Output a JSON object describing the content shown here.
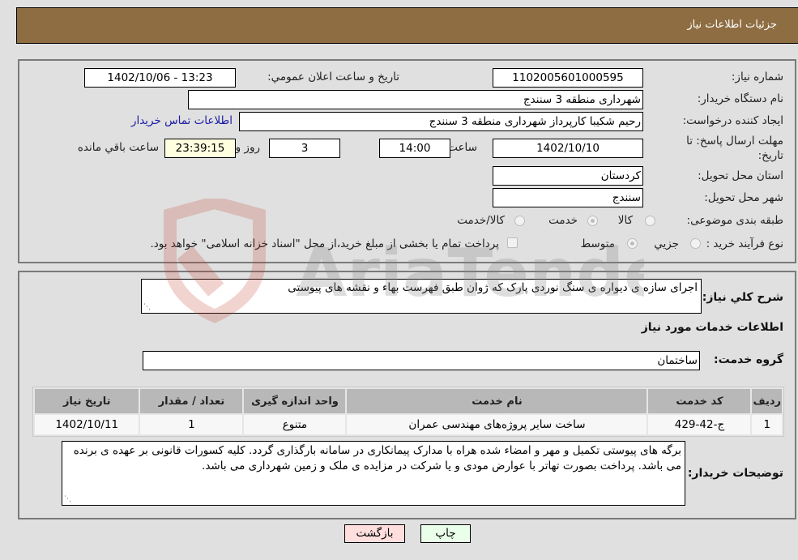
{
  "header": {
    "title": "جزئیات اطلاعات نیاز"
  },
  "form": {
    "need_number": {
      "label": "شماره نیاز:",
      "value": "1102005601000595"
    },
    "announce": {
      "label": "تاریخ و ساعت اعلان عمومي:",
      "value": "1402/10/06 - 13:23"
    },
    "buyer_org": {
      "label": "نام دستگاه خریدار:",
      "value": "شهرداری منطقه 3 سنندج"
    },
    "requester": {
      "label": "ایجاد کننده درخواست:",
      "value": "رحیم شکیبا کارپرداز شهرداری منطقه 3 سنندج",
      "contact_link": "اطلاعات تماس خریدار"
    },
    "deadline": {
      "label": "مهلت ارسال پاسخ: تا تاریخ:",
      "date": "1402/10/10",
      "time_label": "ساعت",
      "time": "14:00",
      "days": "3",
      "days_label": "روز و",
      "remaining": "23:39:15",
      "remaining_label": "ساعت باقي مانده"
    },
    "province": {
      "label": "استان محل تحویل:",
      "value": "کردستان"
    },
    "city": {
      "label": "شهر محل تحویل:",
      "value": "سنندج"
    },
    "category": {
      "label": "طبقه بندی موضوعی:",
      "options": [
        {
          "label": "کالا",
          "selected": false
        },
        {
          "label": "خدمت",
          "selected": true
        },
        {
          "label": "کالا/خدمت",
          "selected": false
        }
      ]
    },
    "process": {
      "label": "نوع فرآیند خرید :",
      "options": [
        {
          "label": "جزيي",
          "selected": false
        },
        {
          "label": "متوسط",
          "selected": true
        }
      ],
      "treasury_note": "پرداخت تمام یا بخشی از مبلغ خرید،از محل \"اسناد خزانه اسلامی\" خواهد بود.",
      "treasury_checked": false
    }
  },
  "details": {
    "summary_label": "شرح کلي نیاز:",
    "summary": "اجرای سازه ی دیواره ی سنگ نوردی پارک که ژوان طبق فهرست بهاء و نقشه های پیوستی",
    "services_heading": "اطلاعات خدمات مورد نیاز",
    "service_group_label": "گروه خدمت:",
    "service_group": "ساختمان",
    "table": {
      "columns": [
        "ردیف",
        "کد خدمت",
        "نام خدمت",
        "واحد اندازه گیری",
        "تعداد / مقدار",
        "تاریخ نیاز"
      ],
      "rows": [
        [
          "1",
          "ج-42-429",
          "ساخت سایر پروژه‌های مهندسی عمران",
          "متنوع",
          "1",
          "1402/10/11"
        ]
      ]
    },
    "buyer_notes_label": "توضیحات خریدار:",
    "buyer_notes": "برگه های پیوستی تکمیل و مهر و امضاء شده هراه با مدارک پیمانکاری در سامانه بارگذاری گردد. کلیه کسورات قانونی بر عهده ی برنده می باشد. پرداخت بصورت تهاتر با عوارض مودی و یا شرکت در مزایده ی ملک و زمین شهرداری می باشد."
  },
  "buttons": {
    "print": "چاپ",
    "back": "بازگشت"
  },
  "colors": {
    "header_bg": "#8e6d42",
    "print_bg": "#eaffea",
    "back_bg": "#ffdede",
    "remaining_bg": "#ffffe0",
    "link": "#1a1aa6"
  }
}
